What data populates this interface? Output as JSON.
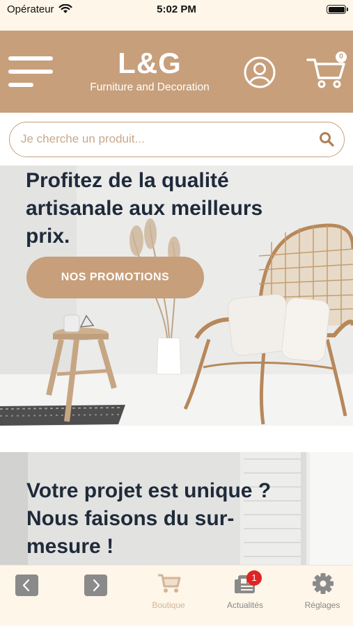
{
  "status_bar": {
    "carrier": "Opérateur",
    "time": "5:02 PM"
  },
  "header": {
    "logo_title": "L&G",
    "logo_subtitle": "Furniture and Decoration",
    "cart_count": "0",
    "brand_color": "#c79f7b",
    "icons": [
      "menu-icon",
      "account-icon",
      "cart-icon"
    ]
  },
  "search": {
    "placeholder": "Je cherche un produit...",
    "value": ""
  },
  "banner_promo": {
    "title": "Profitez de la qualité artisanale aux meilleurs prix.",
    "button_label": "NOS PROMOTIONS"
  },
  "banner_custom": {
    "title": "Votre projet est unique ? Nous faisons du sur-mesure !"
  },
  "tabbar": {
    "tabs": [
      {
        "label": "Boutique",
        "icon": "cart-icon",
        "active": true
      },
      {
        "label": "Actualités",
        "icon": "news-icon",
        "badge": "1"
      },
      {
        "label": "Réglages",
        "icon": "gear-icon"
      }
    ]
  }
}
